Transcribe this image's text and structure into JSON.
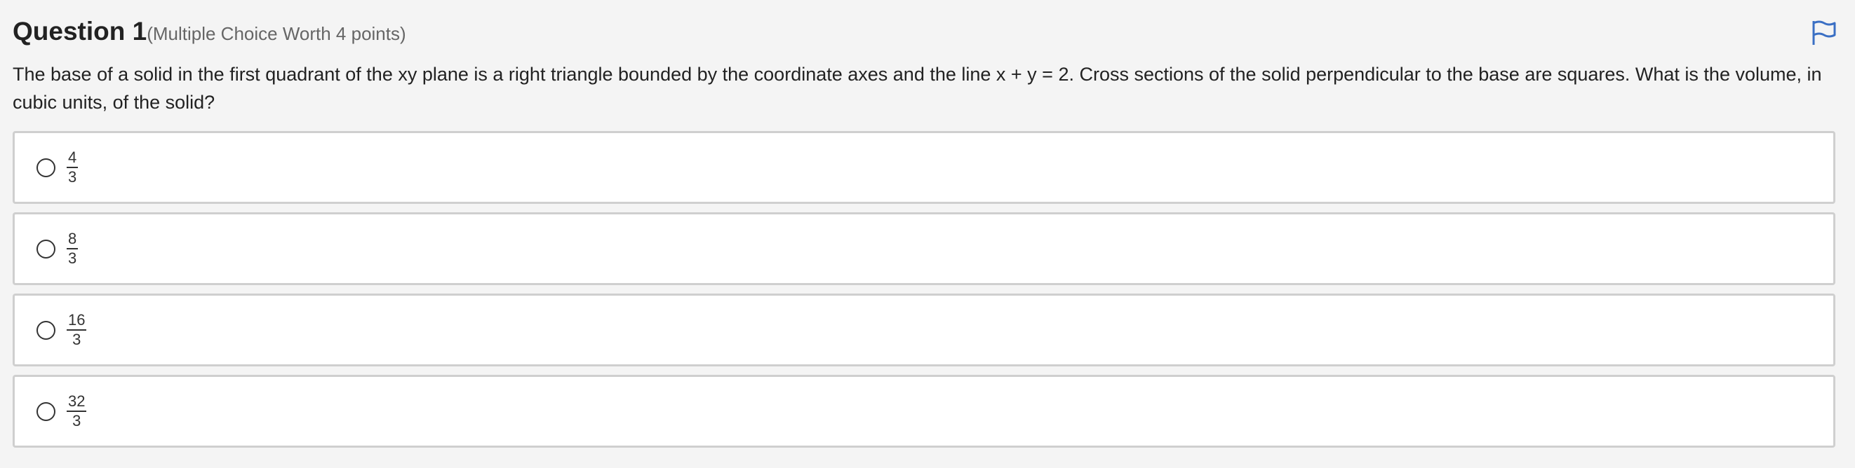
{
  "question": {
    "title": "Question 1",
    "worth": "(Multiple Choice Worth 4 points)",
    "text": "The base of a solid in the first quadrant of the xy plane is a right triangle bounded by the coordinate axes and the line x + y = 2. Cross sections of the solid perpendicular to the base are squares. What is the volume, in cubic units, of the solid?",
    "flag_icon": "flag-icon"
  },
  "options": [
    {
      "numerator": "4",
      "denominator": "3"
    },
    {
      "numerator": "8",
      "denominator": "3"
    },
    {
      "numerator": "16",
      "denominator": "3"
    },
    {
      "numerator": "32",
      "denominator": "3"
    }
  ],
  "colors": {
    "flag": "#3a6fc4",
    "background": "#f4f4f4",
    "option_border": "#cfcfcf"
  }
}
